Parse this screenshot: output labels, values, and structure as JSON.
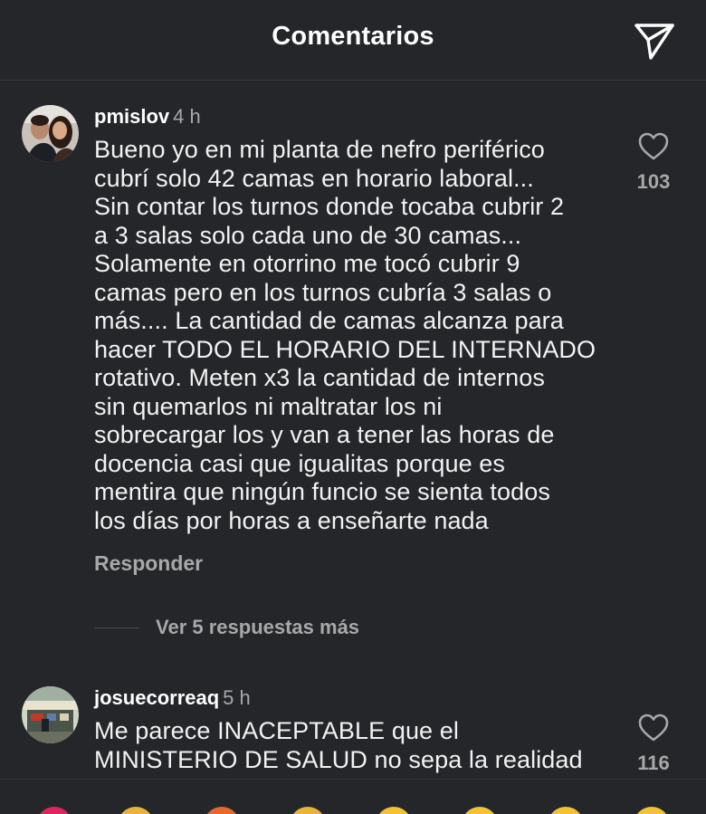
{
  "header": {
    "title": "Comentarios"
  },
  "comments": [
    {
      "username": "pmislov",
      "time": "4 h",
      "text": "Bueno yo en mi planta de nefro periférico\ncubrí solo 42 camas en horario laboral...\nSin contar los turnos donde tocaba cubrir 2\na 3 salas solo cada uno de 30 camas...\nSolamente en otorrino me tocó cubrir 9\ncamas pero en los turnos cubría 3 salas o\nmás.... La cantidad de camas alcanza para\nhacer TODO EL HORARIO DEL INTERNADO\nrotativo. Meten x3 la cantidad de internos\nsin quemarlos ni maltratar los ni\nsobrecargar los y van a tener las horas de\ndocencia casi que igualitas porque es\nmentira que ningún funcio se sienta todos\nlos días por horas a enseñarte nada",
      "likes": "103",
      "reply_label": "Responder",
      "more_replies": "Ver 5 respuestas más"
    },
    {
      "username": "josuecorreaq",
      "time": "5 h",
      "text": "Me parece INACEPTABLE que el\nMINISTERIO DE SALUD no sepa la realidad",
      "likes": "116"
    }
  ],
  "icons": {
    "share": "paper-plane-icon",
    "like": "heart-outline-icon"
  },
  "colors": {
    "background": "#25262a",
    "text": "#f2f2f2",
    "muted": "#a8a8a8"
  }
}
